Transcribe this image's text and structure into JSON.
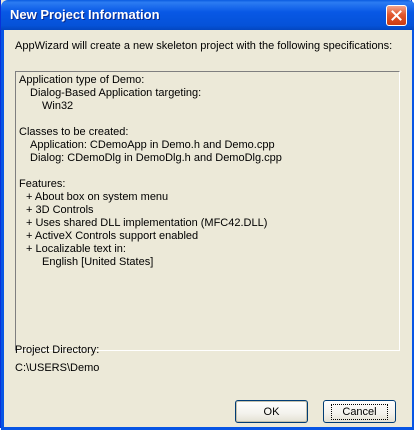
{
  "window": {
    "title": "New Project Information"
  },
  "intro": "AppWizard will create a new skeleton project with the following specifications:",
  "specs": [
    {
      "text": "Application type of Demo:",
      "indent": 0
    },
    {
      "text": "Dialog-Based Application targeting:",
      "indent": 1
    },
    {
      "text": "Win32",
      "indent": 2
    },
    {
      "text": "",
      "indent": 0
    },
    {
      "text": "Classes to be created:",
      "indent": 0
    },
    {
      "text": "Application: CDemoApp in Demo.h and Demo.cpp",
      "indent": 1
    },
    {
      "text": "Dialog: CDemoDlg in DemoDlg.h and DemoDlg.cpp",
      "indent": 1
    },
    {
      "text": "",
      "indent": 0
    },
    {
      "text": "Features:",
      "indent": 0
    },
    {
      "text": "+ About box on system menu",
      "indent": 1
    },
    {
      "text": "+ 3D Controls",
      "indent": 1
    },
    {
      "text": "+ Uses shared DLL implementation (MFC42.DLL)",
      "indent": 1
    },
    {
      "text": "+ ActiveX Controls support enabled",
      "indent": 1
    },
    {
      "text": "+ Localizable text in:",
      "indent": 1
    },
    {
      "text": "English [United States]",
      "indent": 2
    }
  ],
  "project_directory": {
    "label": "Project Directory:",
    "value": "C:\\USERS\\Demo"
  },
  "buttons": {
    "ok": "OK",
    "cancel": "Cancel"
  },
  "colors": {
    "titlebar": "#0858e6",
    "face": "#ece9d8",
    "close_button": "#e2582f"
  },
  "icons": {
    "close": "close-icon"
  }
}
